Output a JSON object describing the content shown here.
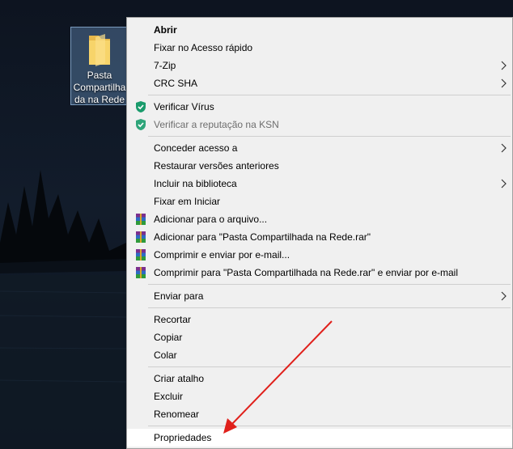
{
  "desktop": {
    "folder_label": "Pasta Compartilhada na Rede"
  },
  "menu": {
    "open": "Abrir",
    "pin_quick_access": "Fixar no Acesso rápido",
    "seven_zip": "7-Zip",
    "crc_sha": "CRC SHA",
    "scan_virus": "Verificar Vírus",
    "check_reputation": "Verificar a reputação na KSN",
    "give_access": "Conceder acesso a",
    "restore_versions": "Restaurar versões anteriores",
    "include_library": "Incluir na biblioteca",
    "pin_start": "Fixar em Iniciar",
    "add_archive": "Adicionar para o arquivo...",
    "add_to_rar": "Adicionar para \"Pasta Compartilhada na Rede.rar\"",
    "compress_email": "Comprimir e enviar por e-mail...",
    "compress_rar_email": "Comprimir para \"Pasta Compartilhada na Rede.rar\" e enviar por e-mail",
    "send_to": "Enviar para",
    "cut": "Recortar",
    "copy": "Copiar",
    "paste": "Colar",
    "create_shortcut": "Criar atalho",
    "delete": "Excluir",
    "rename": "Renomear",
    "properties": "Propriedades"
  },
  "colors": {
    "menu_bg": "#f0f0f0",
    "highlight": "#ffffff",
    "shield_green": "#1a9b6c",
    "annotation_arrow": "#e0201b"
  }
}
